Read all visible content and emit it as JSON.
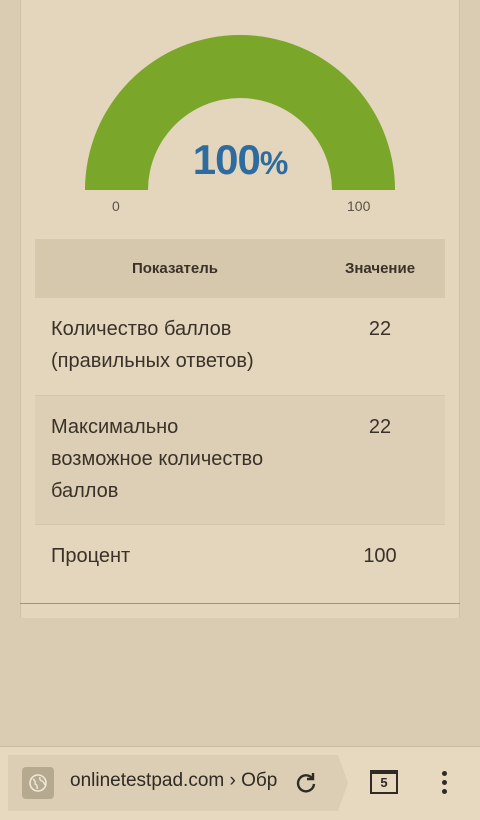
{
  "gauge": {
    "value": 100,
    "percent_number": "100",
    "percent_sign": "%",
    "min_label": "0",
    "max_label": "100",
    "fill_color": "#7aa62a",
    "text_color": "#2e6b9e"
  },
  "table": {
    "header": {
      "name": "Показатель",
      "value": "Значение"
    },
    "rows": [
      {
        "name_line1": "Количество баллов",
        "name_line2": "(правильных ответов)",
        "value": "22"
      },
      {
        "name_line1": "Максимально",
        "name_line2": "возможное количество",
        "name_line3": "баллов",
        "value": "22"
      },
      {
        "name_line1": "Процент",
        "value": "100"
      }
    ]
  },
  "browser": {
    "url": "onlinetestpad.com › Обр",
    "tab_count": "5",
    "icons": [
      "globe-icon",
      "reload-icon",
      "tabs-icon",
      "menu-dots-icon"
    ]
  }
}
